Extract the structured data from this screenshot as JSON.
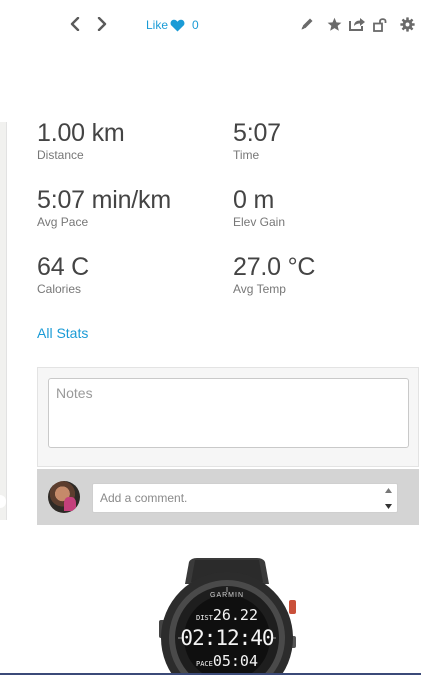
{
  "toolbar": {
    "prev_icon": "chevron-left-icon",
    "next_icon": "chevron-right-icon",
    "like_label": "Like",
    "like_count": "0",
    "icons": [
      "pencil-icon",
      "star-icon",
      "share-icon",
      "unlock-icon",
      "gear-icon"
    ]
  },
  "stats": [
    {
      "value": "1.00 km",
      "label": "Distance"
    },
    {
      "value": "5:07",
      "label": "Time"
    },
    {
      "value": "5:07 min/km",
      "label": "Avg Pace"
    },
    {
      "value": "0 m",
      "label": "Elev Gain"
    },
    {
      "value": "64 C",
      "label": "Calories"
    },
    {
      "value": "27.0 °C",
      "label": "Avg Temp"
    }
  ],
  "all_stats_link": "All Stats",
  "notes": {
    "placeholder": "Notes",
    "value": ""
  },
  "comment": {
    "placeholder": "Add a comment.",
    "value": ""
  },
  "device": {
    "brand": "GARMIN",
    "line1_label": "DIST",
    "line1_value": "26.22",
    "line2_value": "02:12:40",
    "line3_label": "PACE",
    "line3_value": "05:04"
  },
  "colors": {
    "accent": "#1a9bd6",
    "comment_bar": "#d4d4d4",
    "notes_bg": "#f6f6f6"
  }
}
